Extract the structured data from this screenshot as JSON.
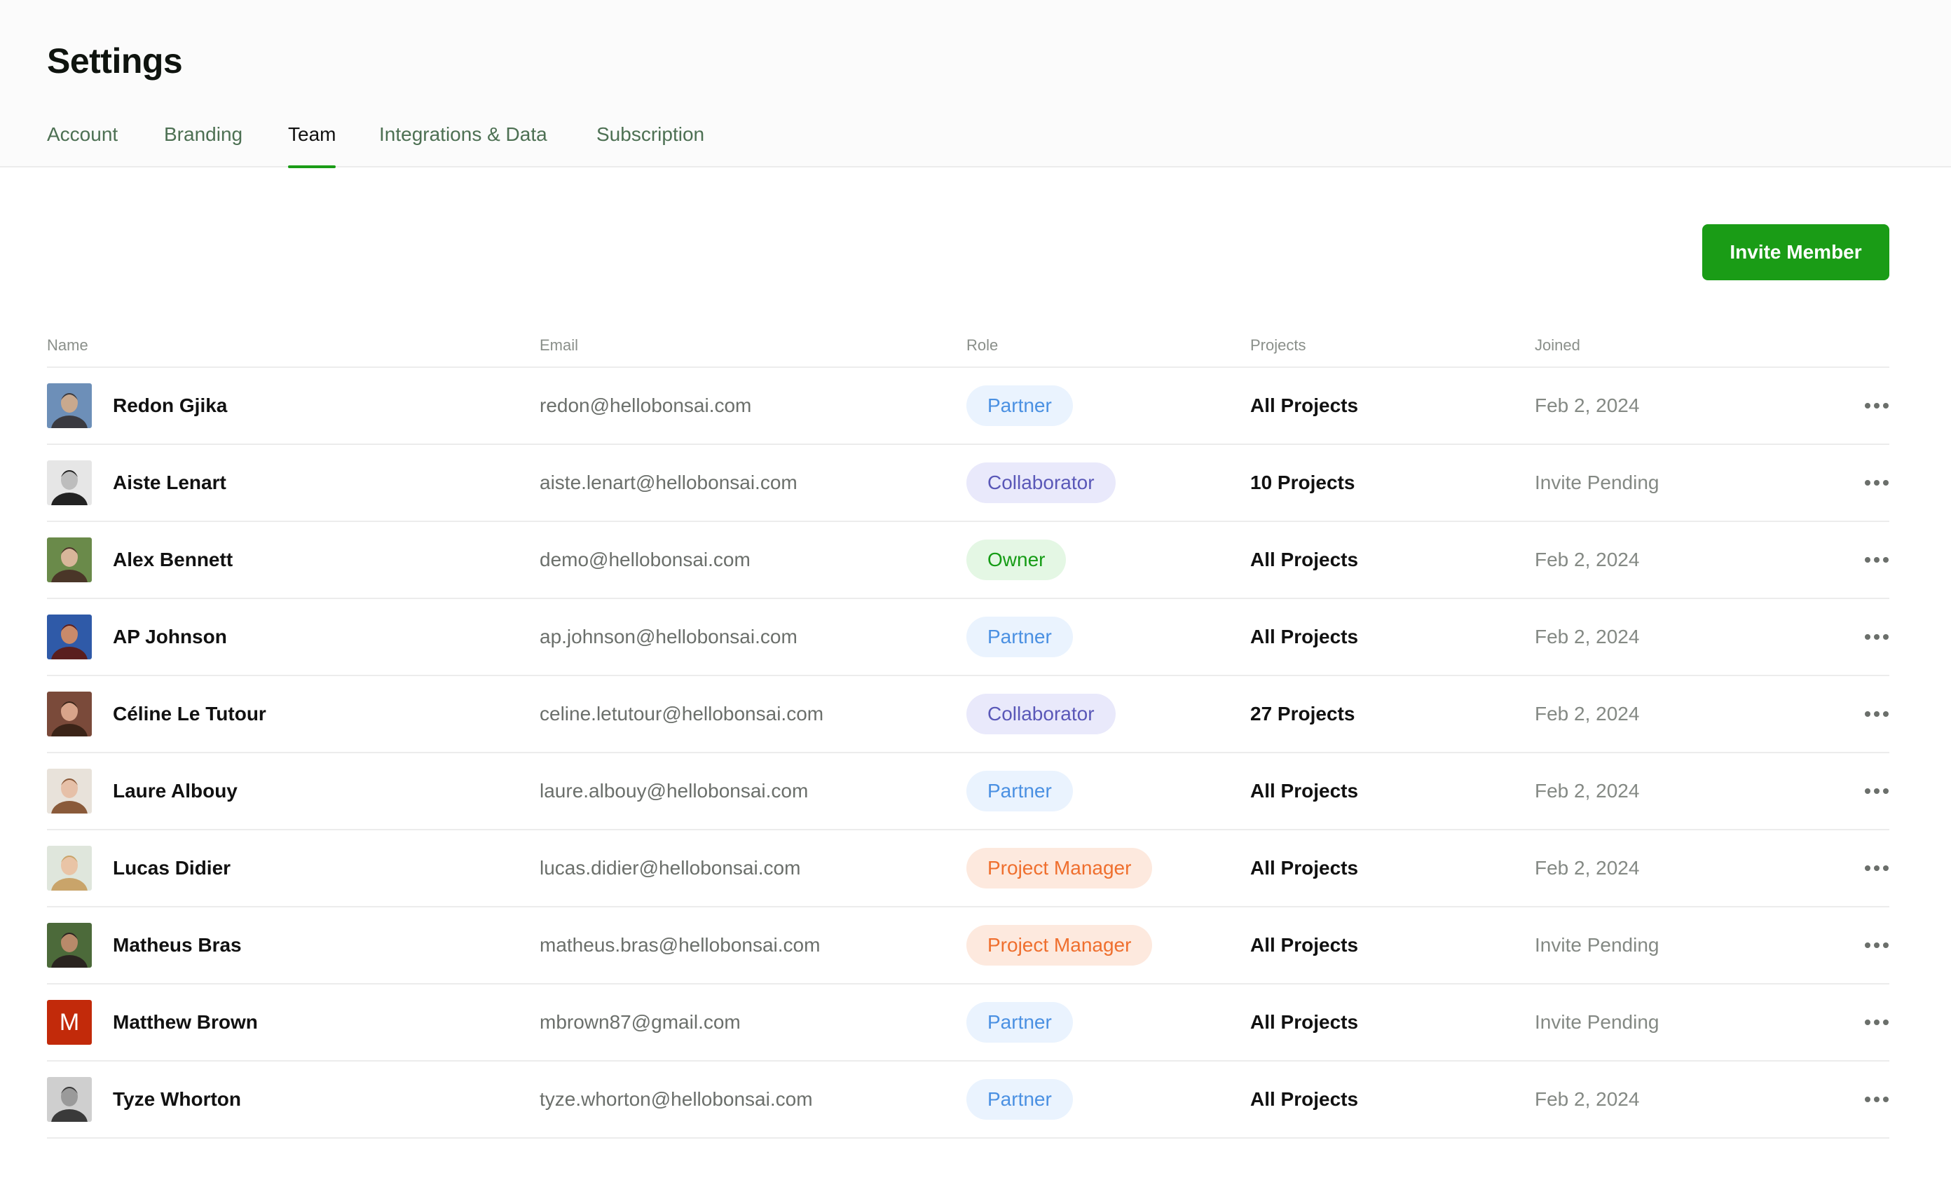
{
  "page": {
    "title": "Settings"
  },
  "tabs": [
    {
      "label": "Account"
    },
    {
      "label": "Branding"
    },
    {
      "label": "Team",
      "active": true
    },
    {
      "label": "Integrations & Data"
    },
    {
      "label": "Subscription"
    }
  ],
  "actions": {
    "invite_label": "Invite Member"
  },
  "table": {
    "headers": {
      "name": "Name",
      "email": "Email",
      "role": "Role",
      "projects": "Projects",
      "joined": "Joined"
    },
    "rows": [
      {
        "name": "Redon Gjika",
        "email": "redon@hellobonsai.com",
        "role": "Partner",
        "projects": "All Projects",
        "joined": "Feb 2, 2024"
      },
      {
        "name": "Aiste Lenart",
        "email": "aiste.lenart@hellobonsai.com",
        "role": "Collaborator",
        "projects": "10 Projects",
        "joined": "Invite Pending"
      },
      {
        "name": "Alex Bennett",
        "email": "demo@hellobonsai.com",
        "role": "Owner",
        "projects": "All Projects",
        "joined": "Feb 2, 2024"
      },
      {
        "name": "AP Johnson",
        "email": "ap.johnson@hellobonsai.com",
        "role": "Partner",
        "projects": "All Projects",
        "joined": "Feb 2, 2024"
      },
      {
        "name": "Céline Le Tutour",
        "email": "celine.letutour@hellobonsai.com",
        "role": "Collaborator",
        "projects": "27 Projects",
        "joined": "Feb 2, 2024"
      },
      {
        "name": "Laure Albouy",
        "email": "laure.albouy@hellobonsai.com",
        "role": "Partner",
        "projects": "All Projects",
        "joined": "Feb 2, 2024"
      },
      {
        "name": "Lucas Didier",
        "email": "lucas.didier@hellobonsai.com",
        "role": "Project Manager",
        "projects": "All Projects",
        "joined": "Feb 2, 2024"
      },
      {
        "name": "Matheus Bras",
        "email": "matheus.bras@hellobonsai.com",
        "role": "Project Manager",
        "projects": "All Projects",
        "joined": "Invite Pending"
      },
      {
        "name": "Matthew Brown",
        "email": "mbrown87@gmail.com",
        "role": "Partner",
        "projects": "All Projects",
        "joined": "Invite Pending",
        "avatar_letter": "M"
      },
      {
        "name": "Tyze Whorton",
        "email": "tyze.whorton@hellobonsai.com",
        "role": "Partner",
        "projects": "All Projects",
        "joined": "Feb 2, 2024"
      }
    ]
  },
  "colors": {
    "accent": "#1a9c16",
    "tab_text": "#4d7053",
    "partner_bg": "#eaf3fe",
    "partner_fg": "#4a90e2",
    "collaborator_bg": "#e9e9fb",
    "collaborator_fg": "#5a58b8",
    "owner_bg": "#e4f7e4",
    "owner_fg": "#169c16",
    "project_manager_bg": "#fde9de",
    "project_manager_fg": "#ef6f2e",
    "letter_avatar_bg": "#c22a0a"
  },
  "icons": {
    "row_menu": "more-horizontal-icon",
    "avatar": "user-photo-avatar"
  }
}
